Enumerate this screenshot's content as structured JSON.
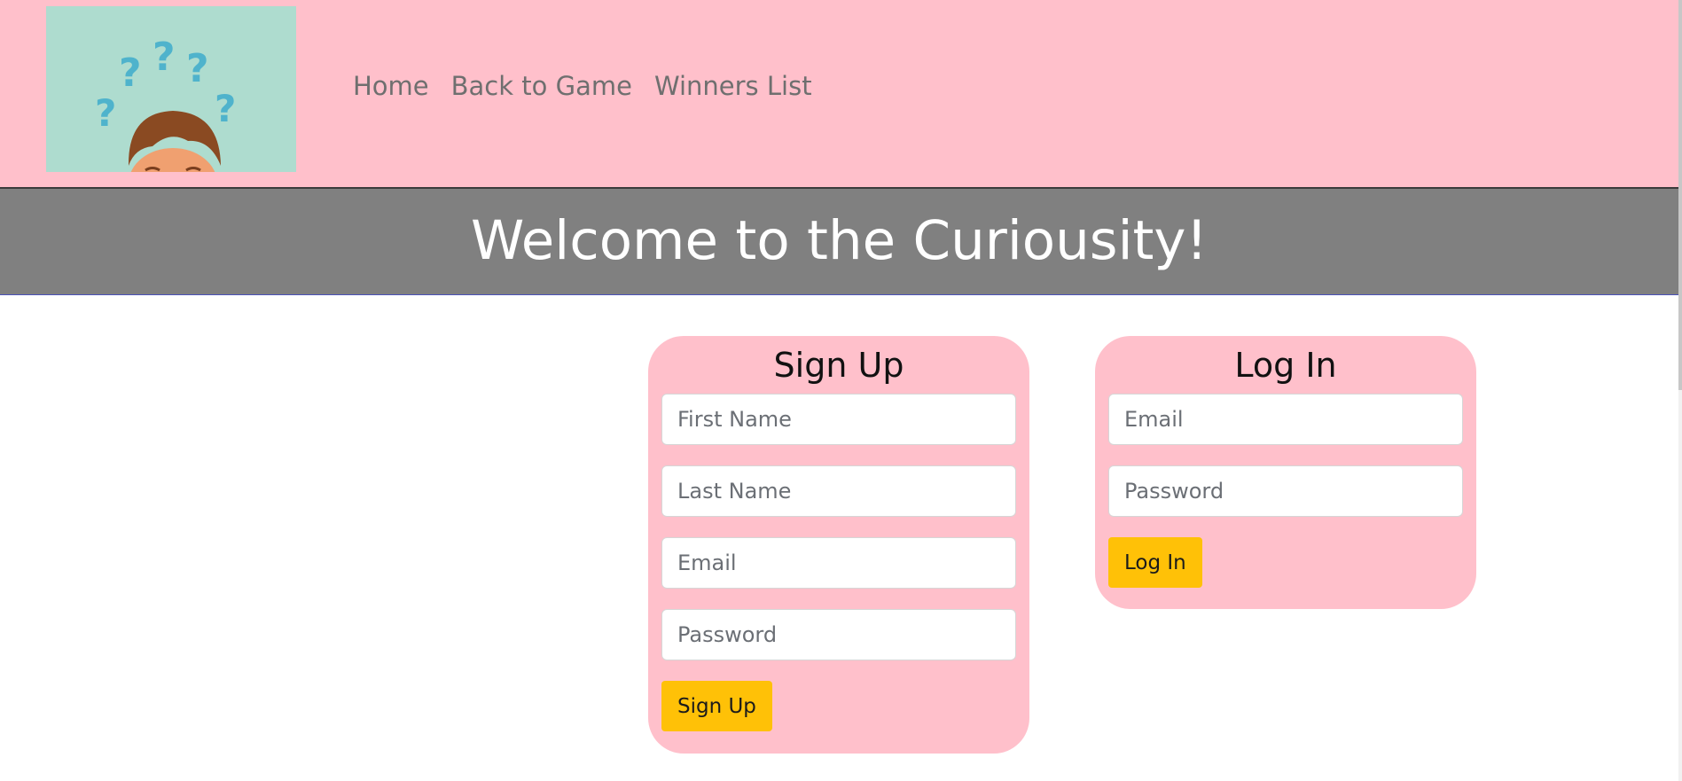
{
  "nav": {
    "items": [
      {
        "label": "Home"
      },
      {
        "label": "Back to Game"
      },
      {
        "label": "Winners List"
      }
    ]
  },
  "banner": {
    "title": "Welcome to the Curiousity!"
  },
  "signup": {
    "title": "Sign Up",
    "first_name_placeholder": "First Name",
    "last_name_placeholder": "Last Name",
    "email_placeholder": "Email",
    "password_placeholder": "Password",
    "button_label": "Sign Up"
  },
  "login": {
    "title": "Log In",
    "email_placeholder": "Email",
    "password_placeholder": "Password",
    "button_label": "Log In"
  },
  "colors": {
    "header_bg": "#ffc0cb",
    "banner_bg": "#808080",
    "card_bg": "#ffc0cb",
    "button_bg": "#ffc107",
    "logo_bg": "#aedccf"
  }
}
